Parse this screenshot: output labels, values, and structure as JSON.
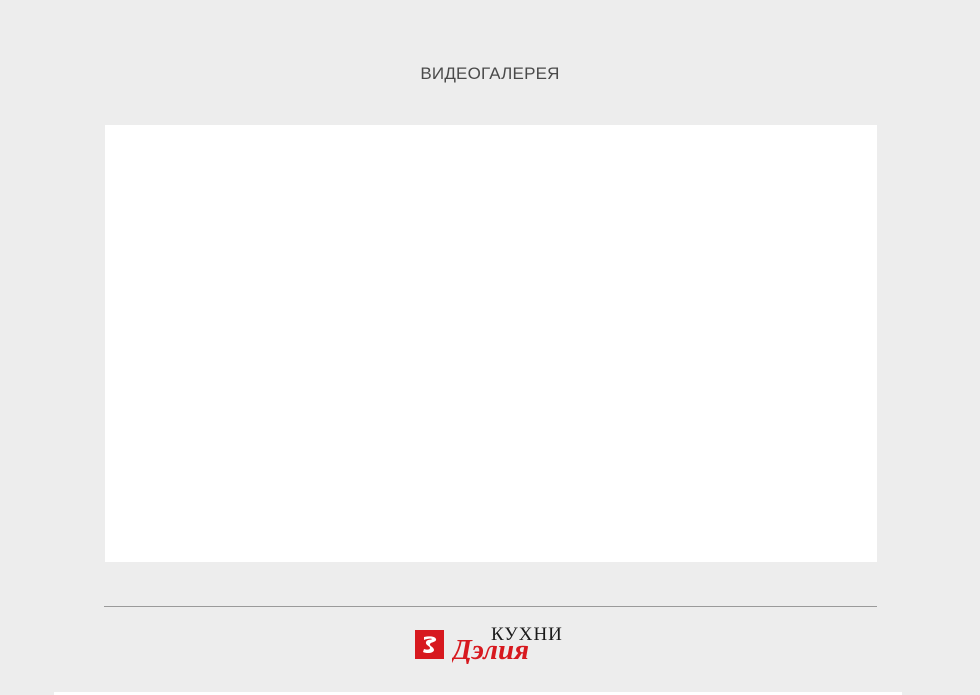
{
  "page": {
    "title": "ВИДЕОГАЛЕРЕЯ"
  },
  "logo": {
    "top_text": "КУХНИ",
    "script_text": "Дэлия",
    "brand_color": "#d7191f",
    "icon": "brand-mark-icon"
  },
  "colors": {
    "background": "#ededed",
    "video_area": "#ffffff",
    "divider": "#9a9a9a"
  }
}
